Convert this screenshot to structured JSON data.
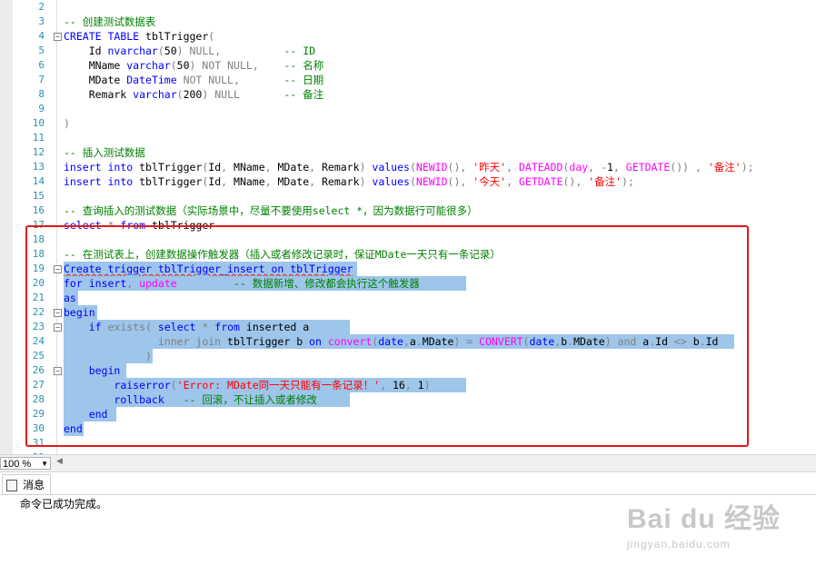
{
  "editor": {
    "lines": [
      {
        "num": "2",
        "tokens": []
      },
      {
        "num": "3",
        "tokens": [
          {
            "t": "-- 创建测试数据表",
            "c": "c"
          }
        ]
      },
      {
        "num": "4",
        "fold": "−",
        "tokens": [
          {
            "t": "CREATE",
            "c": "k"
          },
          {
            "t": " "
          },
          {
            "t": "TABLE",
            "c": "k"
          },
          {
            "t": " tblTrigger"
          },
          {
            "t": "(",
            "c": "g"
          }
        ]
      },
      {
        "num": "5",
        "tokens": [
          {
            "t": "    Id "
          },
          {
            "t": "nvarchar",
            "c": "k"
          },
          {
            "t": "(",
            "c": "g"
          },
          {
            "t": "50"
          },
          {
            "t": ")",
            "c": "g"
          },
          {
            "t": " "
          },
          {
            "t": "NULL",
            "c": "g"
          },
          {
            "t": ",",
            "c": "g"
          },
          {
            "t": "          "
          },
          {
            "t": "-- ID",
            "c": "c"
          }
        ]
      },
      {
        "num": "6",
        "tokens": [
          {
            "t": "    MName "
          },
          {
            "t": "varchar",
            "c": "k"
          },
          {
            "t": "(",
            "c": "g"
          },
          {
            "t": "50"
          },
          {
            "t": ")",
            "c": "g"
          },
          {
            "t": " "
          },
          {
            "t": "NOT NULL",
            "c": "g"
          },
          {
            "t": ",",
            "c": "g"
          },
          {
            "t": "    "
          },
          {
            "t": "-- 名称",
            "c": "c"
          }
        ]
      },
      {
        "num": "7",
        "tokens": [
          {
            "t": "    MDate "
          },
          {
            "t": "DateTime",
            "c": "k"
          },
          {
            "t": " "
          },
          {
            "t": "NOT NULL",
            "c": "g"
          },
          {
            "t": ",",
            "c": "g"
          },
          {
            "t": "       "
          },
          {
            "t": "-- 日期",
            "c": "c"
          }
        ]
      },
      {
        "num": "8",
        "tokens": [
          {
            "t": "    Remark "
          },
          {
            "t": "varchar",
            "c": "k"
          },
          {
            "t": "(",
            "c": "g"
          },
          {
            "t": "200"
          },
          {
            "t": ")",
            "c": "g"
          },
          {
            "t": " "
          },
          {
            "t": "NULL",
            "c": "g"
          },
          {
            "t": "       "
          },
          {
            "t": "-- 备注",
            "c": "c"
          }
        ]
      },
      {
        "num": "9",
        "tokens": []
      },
      {
        "num": "10",
        "tokens": [
          {
            "t": ")",
            "c": "g"
          }
        ]
      },
      {
        "num": "11",
        "tokens": []
      },
      {
        "num": "12",
        "tokens": [
          {
            "t": "-- 插入测试数据",
            "c": "c"
          }
        ]
      },
      {
        "num": "13",
        "tokens": [
          {
            "t": "insert",
            "c": "k"
          },
          {
            "t": " "
          },
          {
            "t": "into",
            "c": "k"
          },
          {
            "t": " tblTrigger"
          },
          {
            "t": "(",
            "c": "g"
          },
          {
            "t": "Id"
          },
          {
            "t": ",",
            "c": "g"
          },
          {
            "t": " MName"
          },
          {
            "t": ",",
            "c": "g"
          },
          {
            "t": " MDate"
          },
          {
            "t": ",",
            "c": "g"
          },
          {
            "t": " Remark"
          },
          {
            "t": ")",
            "c": "g"
          },
          {
            "t": " "
          },
          {
            "t": "values",
            "c": "k"
          },
          {
            "t": "(",
            "c": "g"
          },
          {
            "t": "NEWID",
            "c": "f"
          },
          {
            "t": "()",
            "c": "g"
          },
          {
            "t": ",",
            "c": "g"
          },
          {
            "t": " "
          },
          {
            "t": "'昨天'",
            "c": "s"
          },
          {
            "t": ",",
            "c": "g"
          },
          {
            "t": " "
          },
          {
            "t": "DATEADD",
            "c": "f"
          },
          {
            "t": "(",
            "c": "g"
          },
          {
            "t": "day",
            "c": "f"
          },
          {
            "t": ",",
            "c": "g"
          },
          {
            "t": " "
          },
          {
            "t": "-",
            "c": "g"
          },
          {
            "t": "1"
          },
          {
            "t": ",",
            "c": "g"
          },
          {
            "t": " "
          },
          {
            "t": "GETDATE",
            "c": "f"
          },
          {
            "t": "())",
            "c": "g"
          },
          {
            "t": " "
          },
          {
            "t": ",",
            "c": "g"
          },
          {
            "t": " "
          },
          {
            "t": "'备注'",
            "c": "s"
          },
          {
            "t": ");",
            "c": "g"
          }
        ]
      },
      {
        "num": "14",
        "tokens": [
          {
            "t": "insert",
            "c": "k"
          },
          {
            "t": " "
          },
          {
            "t": "into",
            "c": "k"
          },
          {
            "t": " tblTrigger"
          },
          {
            "t": "(",
            "c": "g"
          },
          {
            "t": "Id"
          },
          {
            "t": ",",
            "c": "g"
          },
          {
            "t": " MName"
          },
          {
            "t": ",",
            "c": "g"
          },
          {
            "t": " MDate"
          },
          {
            "t": ",",
            "c": "g"
          },
          {
            "t": " Remark"
          },
          {
            "t": ")",
            "c": "g"
          },
          {
            "t": " "
          },
          {
            "t": "values",
            "c": "k"
          },
          {
            "t": "(",
            "c": "g"
          },
          {
            "t": "NEWID",
            "c": "f"
          },
          {
            "t": "()",
            "c": "g"
          },
          {
            "t": ",",
            "c": "g"
          },
          {
            "t": " "
          },
          {
            "t": "'今天'",
            "c": "s"
          },
          {
            "t": ",",
            "c": "g"
          },
          {
            "t": " "
          },
          {
            "t": "GETDATE",
            "c": "f"
          },
          {
            "t": "()",
            "c": "g"
          },
          {
            "t": ",",
            "c": "g"
          },
          {
            "t": " "
          },
          {
            "t": "'备注'",
            "c": "s"
          },
          {
            "t": ");",
            "c": "g"
          }
        ]
      },
      {
        "num": "15",
        "tokens": []
      },
      {
        "num": "16",
        "tokens": [
          {
            "t": "-- 查询插入的测试数据（实际场景中，尽量不要使用select *，因为数据行可能很多）",
            "c": "c"
          }
        ]
      },
      {
        "num": "17",
        "tokens": [
          {
            "t": "select",
            "c": "k"
          },
          {
            "t": " "
          },
          {
            "t": "*",
            "c": "g"
          },
          {
            "t": " "
          },
          {
            "t": "from",
            "c": "k"
          },
          {
            "t": " tblTrigger"
          }
        ]
      },
      {
        "num": "18",
        "tokens": []
      },
      {
        "num": "18",
        "tokens": [
          {
            "t": "-- 在测试表上，创建数据操作触发器（插入或者修改记录时，保证MDate一天只有一条记录）",
            "c": "c"
          }
        ]
      },
      {
        "num": "19",
        "fold": "−",
        "sel": [
          70,
          393
        ],
        "tokens": [
          {
            "t": "Create trigger tblTrigger_insert on tblTrigger",
            "c": "k",
            "err": true
          }
        ]
      },
      {
        "num": "20",
        "sel": [
          70,
          513
        ],
        "tokens": [
          {
            "t": "for",
            "c": "k"
          },
          {
            "t": " "
          },
          {
            "t": "insert",
            "c": "k"
          },
          {
            "t": ",",
            "c": "g"
          },
          {
            "t": " "
          },
          {
            "t": "update",
            "c": "f"
          },
          {
            "t": "         "
          },
          {
            "t": "-- 数据新增、修改都会执行这个触发器",
            "c": "c"
          }
        ]
      },
      {
        "num": "21",
        "sel": [
          70,
          86
        ],
        "tokens": [
          {
            "t": "as",
            "c": "k"
          }
        ]
      },
      {
        "num": "22",
        "fold": "−",
        "sel": [
          70,
          107
        ],
        "tokens": [
          {
            "t": "begin",
            "c": "k"
          }
        ]
      },
      {
        "num": "23",
        "fold": "−",
        "sel": [
          70,
          385
        ],
        "tokens": [
          {
            "t": "    "
          },
          {
            "t": "if",
            "c": "k"
          },
          {
            "t": " "
          },
          {
            "t": "exists",
            "c": "g"
          },
          {
            "t": "(",
            "c": "g"
          },
          {
            "t": " "
          },
          {
            "t": "select",
            "c": "k"
          },
          {
            "t": " "
          },
          {
            "t": "*",
            "c": "g"
          },
          {
            "t": " "
          },
          {
            "t": "from",
            "c": "k"
          },
          {
            "t": " inserted a"
          }
        ]
      },
      {
        "num": "24",
        "sel": [
          70,
          808
        ],
        "tokens": [
          {
            "t": "               "
          },
          {
            "t": "inner join",
            "c": "g"
          },
          {
            "t": " tblTrigger b "
          },
          {
            "t": "on",
            "c": "k"
          },
          {
            "t": " "
          },
          {
            "t": "convert",
            "c": "f"
          },
          {
            "t": "(",
            "c": "g"
          },
          {
            "t": "date",
            "c": "k"
          },
          {
            "t": ",",
            "c": "g"
          },
          {
            "t": "a"
          },
          {
            "t": ".",
            "c": "g"
          },
          {
            "t": "MDate"
          },
          {
            "t": ")",
            "c": "g"
          },
          {
            "t": " "
          },
          {
            "t": "=",
            "c": "g"
          },
          {
            "t": " "
          },
          {
            "t": "CONVERT",
            "c": "f"
          },
          {
            "t": "(",
            "c": "g"
          },
          {
            "t": "date",
            "c": "k"
          },
          {
            "t": ",",
            "c": "g"
          },
          {
            "t": "b"
          },
          {
            "t": ".",
            "c": "g"
          },
          {
            "t": "MDate"
          },
          {
            "t": ")",
            "c": "g"
          },
          {
            "t": " "
          },
          {
            "t": "and",
            "c": "g"
          },
          {
            "t": " a"
          },
          {
            "t": ".",
            "c": "g"
          },
          {
            "t": "Id "
          },
          {
            "t": "<>",
            "c": "g"
          },
          {
            "t": " b"
          },
          {
            "t": ".",
            "c": "g"
          },
          {
            "t": "Id"
          }
        ]
      },
      {
        "num": "25",
        "sel": [
          70,
          168
        ],
        "tokens": [
          {
            "t": "             "
          },
          {
            "t": ")",
            "c": "g"
          }
        ]
      },
      {
        "num": "26",
        "fold": "−",
        "sel": [
          70,
          139
        ],
        "tokens": [
          {
            "t": "    "
          },
          {
            "t": "begin",
            "c": "k"
          }
        ]
      },
      {
        "num": "27",
        "sel": [
          70,
          513
        ],
        "tokens": [
          {
            "t": "        "
          },
          {
            "t": "raiserror",
            "c": "k"
          },
          {
            "t": "(",
            "c": "g"
          },
          {
            "t": "'Error: MDate同一天只能有一条记录！'",
            "c": "s"
          },
          {
            "t": ",",
            "c": "g"
          },
          {
            "t": " 16"
          },
          {
            "t": ",",
            "c": "g"
          },
          {
            "t": " 1"
          },
          {
            "t": ")",
            "c": "g"
          }
        ]
      },
      {
        "num": "28",
        "sel": [
          70,
          385
        ],
        "tokens": [
          {
            "t": "        "
          },
          {
            "t": "rollback",
            "c": "k"
          },
          {
            "t": "   "
          },
          {
            "t": "-- 回滚，不让插入或者修改",
            "c": "c"
          }
        ]
      },
      {
        "num": "29",
        "sel": [
          70,
          128
        ],
        "tokens": [
          {
            "t": "    "
          },
          {
            "t": "end",
            "c": "k"
          }
        ]
      },
      {
        "num": "30",
        "sel": [
          70,
          92
        ],
        "tokens": [
          {
            "t": "end",
            "c": "k"
          }
        ]
      },
      {
        "num": "31",
        "tokens": []
      },
      {
        "num": "32",
        "tokens": []
      }
    ]
  },
  "toolbar": {
    "zoom": "100 %"
  },
  "results": {
    "tab_label": "消息",
    "message": "命令已成功完成。"
  },
  "watermark": {
    "logo": "Bai du 经验",
    "sub": "jingyan.baidu.com"
  }
}
